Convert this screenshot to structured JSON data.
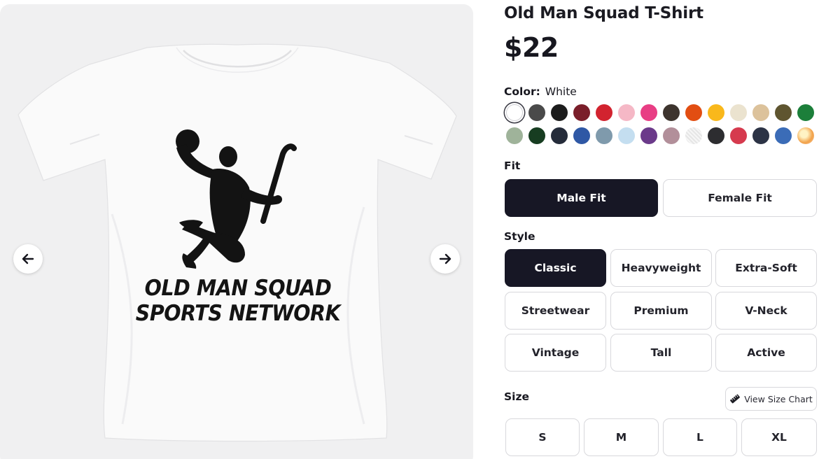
{
  "product": {
    "title": "Old Man Squad T-Shirt",
    "price": "$22"
  },
  "gallery": {
    "print_line_1": "OLD MAN SQUAD",
    "print_line_2": "SPORTS NETWORK",
    "prev_icon": "arrow-left-icon",
    "next_icon": "arrow-right-icon"
  },
  "color": {
    "label": "Color:",
    "selected": "White",
    "swatches": [
      "#ffffff",
      "#4a4a4a",
      "#1c1c1c",
      "#7a1e2a",
      "#d2232f",
      "#f5b8c6",
      "#e83e84",
      "#3d342e",
      "#e24e12",
      "#f9b81b",
      "#ebe3cf",
      "#dcc29b",
      "#5f5530",
      "#1c7f3a",
      "#9fb39a",
      "#173d21",
      "#252c3a",
      "#2f58a5",
      "#7f9aac",
      "#c4def0",
      "#6b3a8a",
      "#b28f9a",
      "#e8e8e8",
      "#2d2d30",
      "#d63a4e",
      "#2c3345",
      "#3b6cb7",
      "#f2a24a"
    ]
  },
  "fit": {
    "label": "Fit",
    "options": [
      "Male Fit",
      "Female Fit"
    ],
    "selected": "Male Fit"
  },
  "style": {
    "label": "Style",
    "options": [
      "Classic",
      "Heavyweight",
      "Extra-Soft",
      "Streetwear",
      "Premium",
      "V-Neck",
      "Vintage",
      "Tall",
      "Active"
    ],
    "selected": "Classic"
  },
  "size": {
    "label": "Size",
    "chart_label": "View Size Chart",
    "chart_icon": "ruler-icon",
    "options": [
      "S",
      "M",
      "L",
      "XL"
    ]
  }
}
